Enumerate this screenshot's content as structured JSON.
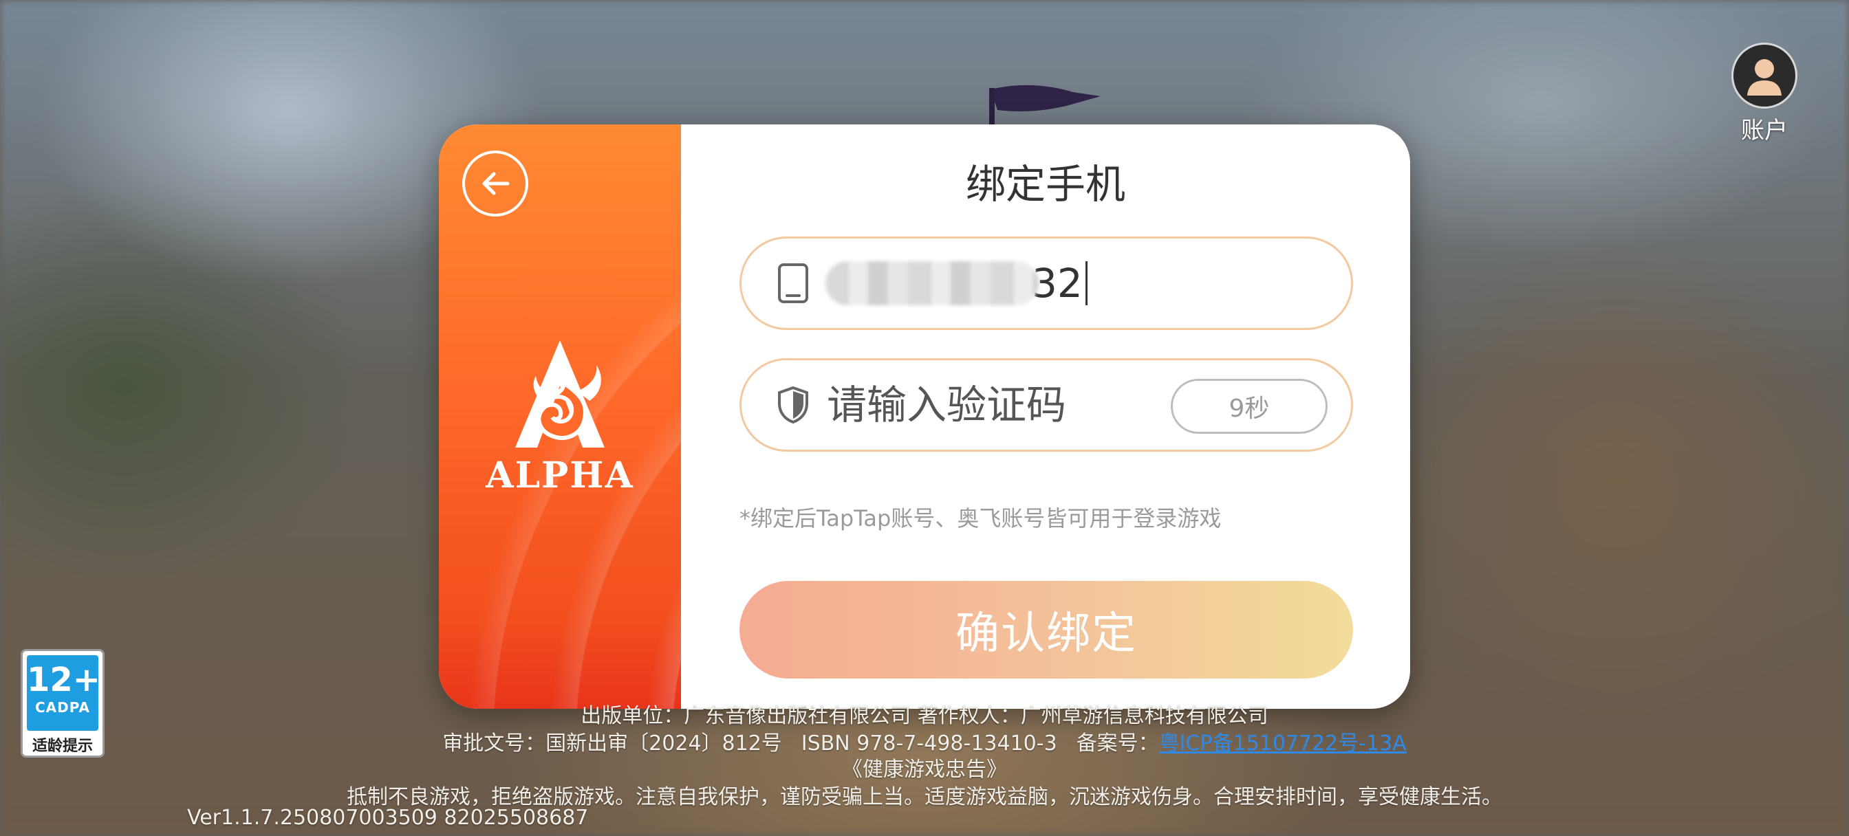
{
  "account": {
    "label": "账户",
    "icon": "user-avatar-icon"
  },
  "dialog": {
    "back_icon": "back-arrow-icon",
    "logo": {
      "icon": "alpha-flame-logo",
      "text": "ALPHA"
    },
    "title": "绑定手机",
    "phone": {
      "icon": "phone-icon",
      "value_suffix": "32"
    },
    "code": {
      "icon": "shield-icon",
      "placeholder": "请输入验证码",
      "timer": "9秒"
    },
    "hint": "*绑定后TapTap账号、奥飞账号皆可用于登录游戏",
    "confirm_label": "确认绑定"
  },
  "age_badge": {
    "number": "12+",
    "org": "CADPA",
    "label": "适龄提示"
  },
  "footer": {
    "line1": "出版单位：广东音像出版社有限公司   著作权人：广州草游信息科技有限公司",
    "approval": "审批文号：国新出审〔2024〕812号",
    "isbn": "ISBN 978-7-498-13410-3",
    "record_label": "备案号：",
    "icp": "粤ICP备15107722号-13A",
    "advice_title": "《健康游戏忠告》",
    "advice": "抵制不良游戏，拒绝盗版游戏。注意自我保护，谨防受骗上当。适度游戏益脑，沉迷游戏伤身。合理安排时间，享受健康生活。",
    "version": "Ver1.1.7.250807003509   82025508687"
  },
  "colors": {
    "accent_orange": "#ff6a2a",
    "field_border": "#f3c9a2",
    "confirm_gradient_start": "#f5ab92",
    "confirm_gradient_end": "#f3dc9a",
    "link": "#2e8ae6",
    "badge_blue": "#1e9de0"
  }
}
